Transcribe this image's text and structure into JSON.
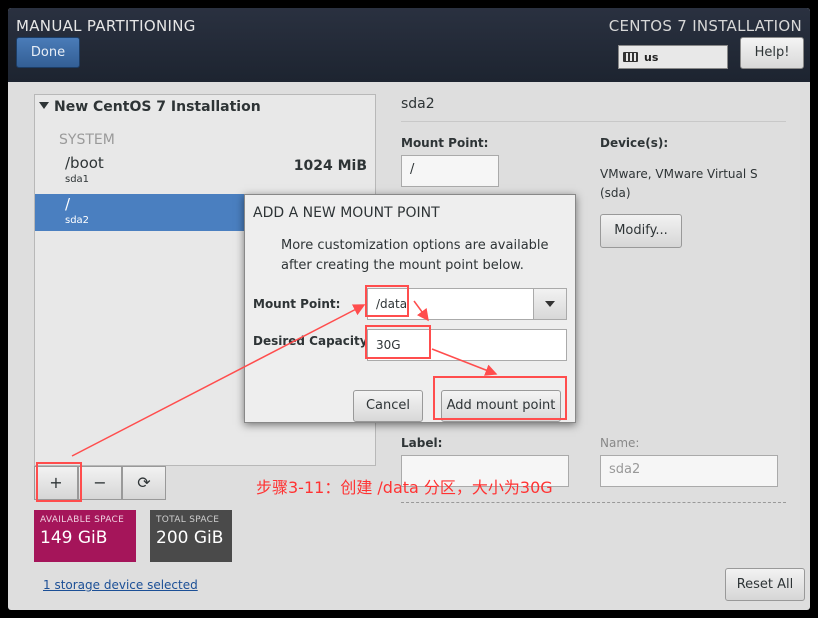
{
  "header": {
    "title": "MANUAL PARTITIONING",
    "right_title": "CENTOS 7 INSTALLATION",
    "done_label": "Done",
    "keyboard_layout": "us",
    "help_label": "Help!"
  },
  "left_panel": {
    "install_title": "New CentOS 7 Installation",
    "system_label": "SYSTEM",
    "partitions": [
      {
        "mount": "/boot",
        "device": "sda1",
        "size": "1024 MiB",
        "selected": false
      },
      {
        "mount": "/",
        "device": "sda2",
        "size": "",
        "selected": true
      }
    ],
    "add_symbol": "+",
    "remove_symbol": "−",
    "refresh_symbol": "⟳"
  },
  "space": {
    "available_label": "AVAILABLE SPACE",
    "available_value": "149 GiB",
    "total_label": "TOTAL SPACE",
    "total_value": "200 GiB"
  },
  "footer": {
    "storage_link": "1 storage device selected",
    "reset_label": "Reset All"
  },
  "right_panel": {
    "title": "sda2",
    "mount_point_label": "Mount Point:",
    "mount_point_value": "/",
    "devices_label": "Device(s):",
    "devices_line1": "VMware, VMware Virtual S",
    "devices_line2": "(sda)",
    "modify_label": "Modify...",
    "label_label": "Label:",
    "name_label": "Name:",
    "name_value": "sda2"
  },
  "dialog": {
    "title": "ADD A NEW MOUNT POINT",
    "description": "More customization options are available after creating the mount point below.",
    "mount_point_label": "Mount Point:",
    "mount_point_value": "/data",
    "capacity_label": "Desired Capacity:",
    "capacity_value": "30G",
    "cancel_label": "Cancel",
    "add_label": "Add mount point"
  },
  "annotation": {
    "text": "步骤3-11：创建 /data 分区，大小为30G",
    "color": "#ff3333"
  }
}
